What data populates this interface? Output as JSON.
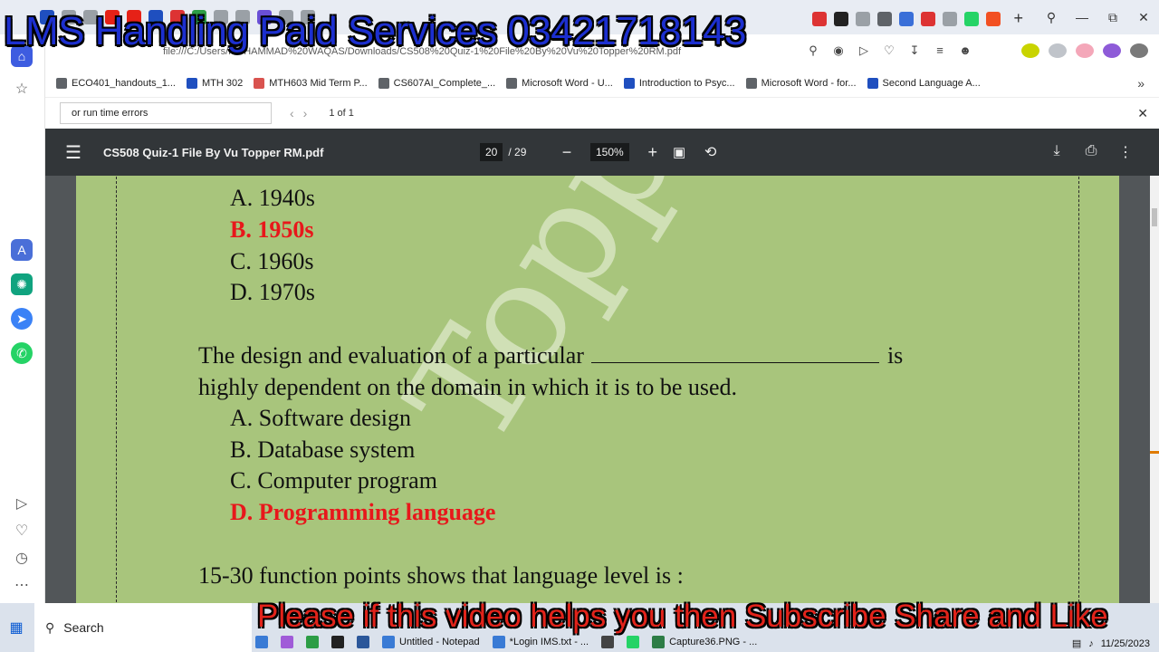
{
  "browser": {
    "url": "file:///C:/Users/MUHAMMAD%20WAQAS/Downloads/CS508%20Quiz-1%20File%20By%20Vu%20Topper%20RM.pdf",
    "new_tab_symbol": "+"
  },
  "bookmarks": [
    {
      "label": "ECO401_handouts_1...",
      "color": "#5f6368"
    },
    {
      "label": "MTH 302",
      "color": "#1f4fbf"
    },
    {
      "label": "MTH603 Mid Term P...",
      "color": "#d9534f"
    },
    {
      "label": "CS607AI_Complete_...",
      "color": "#5f6368"
    },
    {
      "label": "Microsoft Word - U...",
      "color": "#5f6368"
    },
    {
      "label": "Introduction to Psyc...",
      "color": "#1f4fbf"
    },
    {
      "label": "Microsoft Word - for...",
      "color": "#5f6368"
    },
    {
      "label": "Second Language A...",
      "color": "#1f4fbf"
    }
  ],
  "find": {
    "query": "or run time errors",
    "count": "1 of 1"
  },
  "pdf": {
    "title": "CS508 Quiz-1 File By Vu Topper RM.pdf",
    "current_page": "20",
    "total_pages": "/ 29",
    "zoom": "150%"
  },
  "page": {
    "watermark": "Topper RM",
    "q1_options": [
      {
        "letter": "A.",
        "text": "1940s",
        "correct": false
      },
      {
        "letter": "B.",
        "text": "1950s",
        "correct": true
      },
      {
        "letter": "C.",
        "text": "1960s",
        "correct": false
      },
      {
        "letter": "D.",
        "text": "1970s",
        "correct": false
      }
    ],
    "q2_line1_before": "The design and evaluation of a particular",
    "q2_line1_after": "is",
    "q2_line2": "highly dependent on the domain in which it is to be used.",
    "q2_options": [
      {
        "letter": "A.",
        "text": "Software design",
        "correct": false
      },
      {
        "letter": "B.",
        "text": "Database system",
        "correct": false
      },
      {
        "letter": "C.",
        "text": "Computer program",
        "correct": false
      },
      {
        "letter": "D.",
        "text": "Programming language",
        "correct": true
      }
    ],
    "q3": "15-30 function points shows that language level is :"
  },
  "taskbar": {
    "search_label": "Search",
    "apps": [
      {
        "label": "Untitled - Notepad",
        "color": "#3a7bd5"
      },
      {
        "label": "*Login IMS.txt - ...",
        "color": "#3a7bd5"
      },
      {
        "label": "Capture36.PNG - ...",
        "color": "#2d7d46"
      }
    ],
    "date": "11/25/2023"
  },
  "overlay": {
    "top_banner": "LMS Handling Paid Services 03421718143",
    "bottom_banner": "Please if this video helps you then Subscribe Share and Like"
  }
}
